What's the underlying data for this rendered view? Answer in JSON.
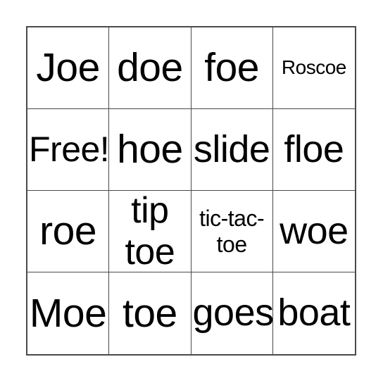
{
  "card": {
    "type": "bingo-card",
    "columns": 4,
    "rows": 4,
    "colors": {
      "background": "#ffffff",
      "grid_line": "#4a4a4a",
      "text": "#000000"
    },
    "cells": [
      {
        "text": "Joe",
        "size": "xl"
      },
      {
        "text": "doe",
        "size": "xl"
      },
      {
        "text": "foe",
        "size": "xl"
      },
      {
        "text": "Roscoe",
        "size": "xs"
      },
      {
        "text": "Free!",
        "size": "wide"
      },
      {
        "text": "hoe",
        "size": "xl"
      },
      {
        "text": "slide",
        "size": "lg"
      },
      {
        "text": "floe",
        "size": "lg"
      },
      {
        "text": "roe",
        "size": "xl"
      },
      {
        "text": "tip toe",
        "size": "two"
      },
      {
        "text": "tic-tac-toe",
        "size": "sm"
      },
      {
        "text": "woe",
        "size": "lg"
      },
      {
        "text": "Moe",
        "size": "xl"
      },
      {
        "text": "toe",
        "size": "xl"
      },
      {
        "text": "goes",
        "size": "lg"
      },
      {
        "text": "boat",
        "size": "lg"
      }
    ]
  }
}
